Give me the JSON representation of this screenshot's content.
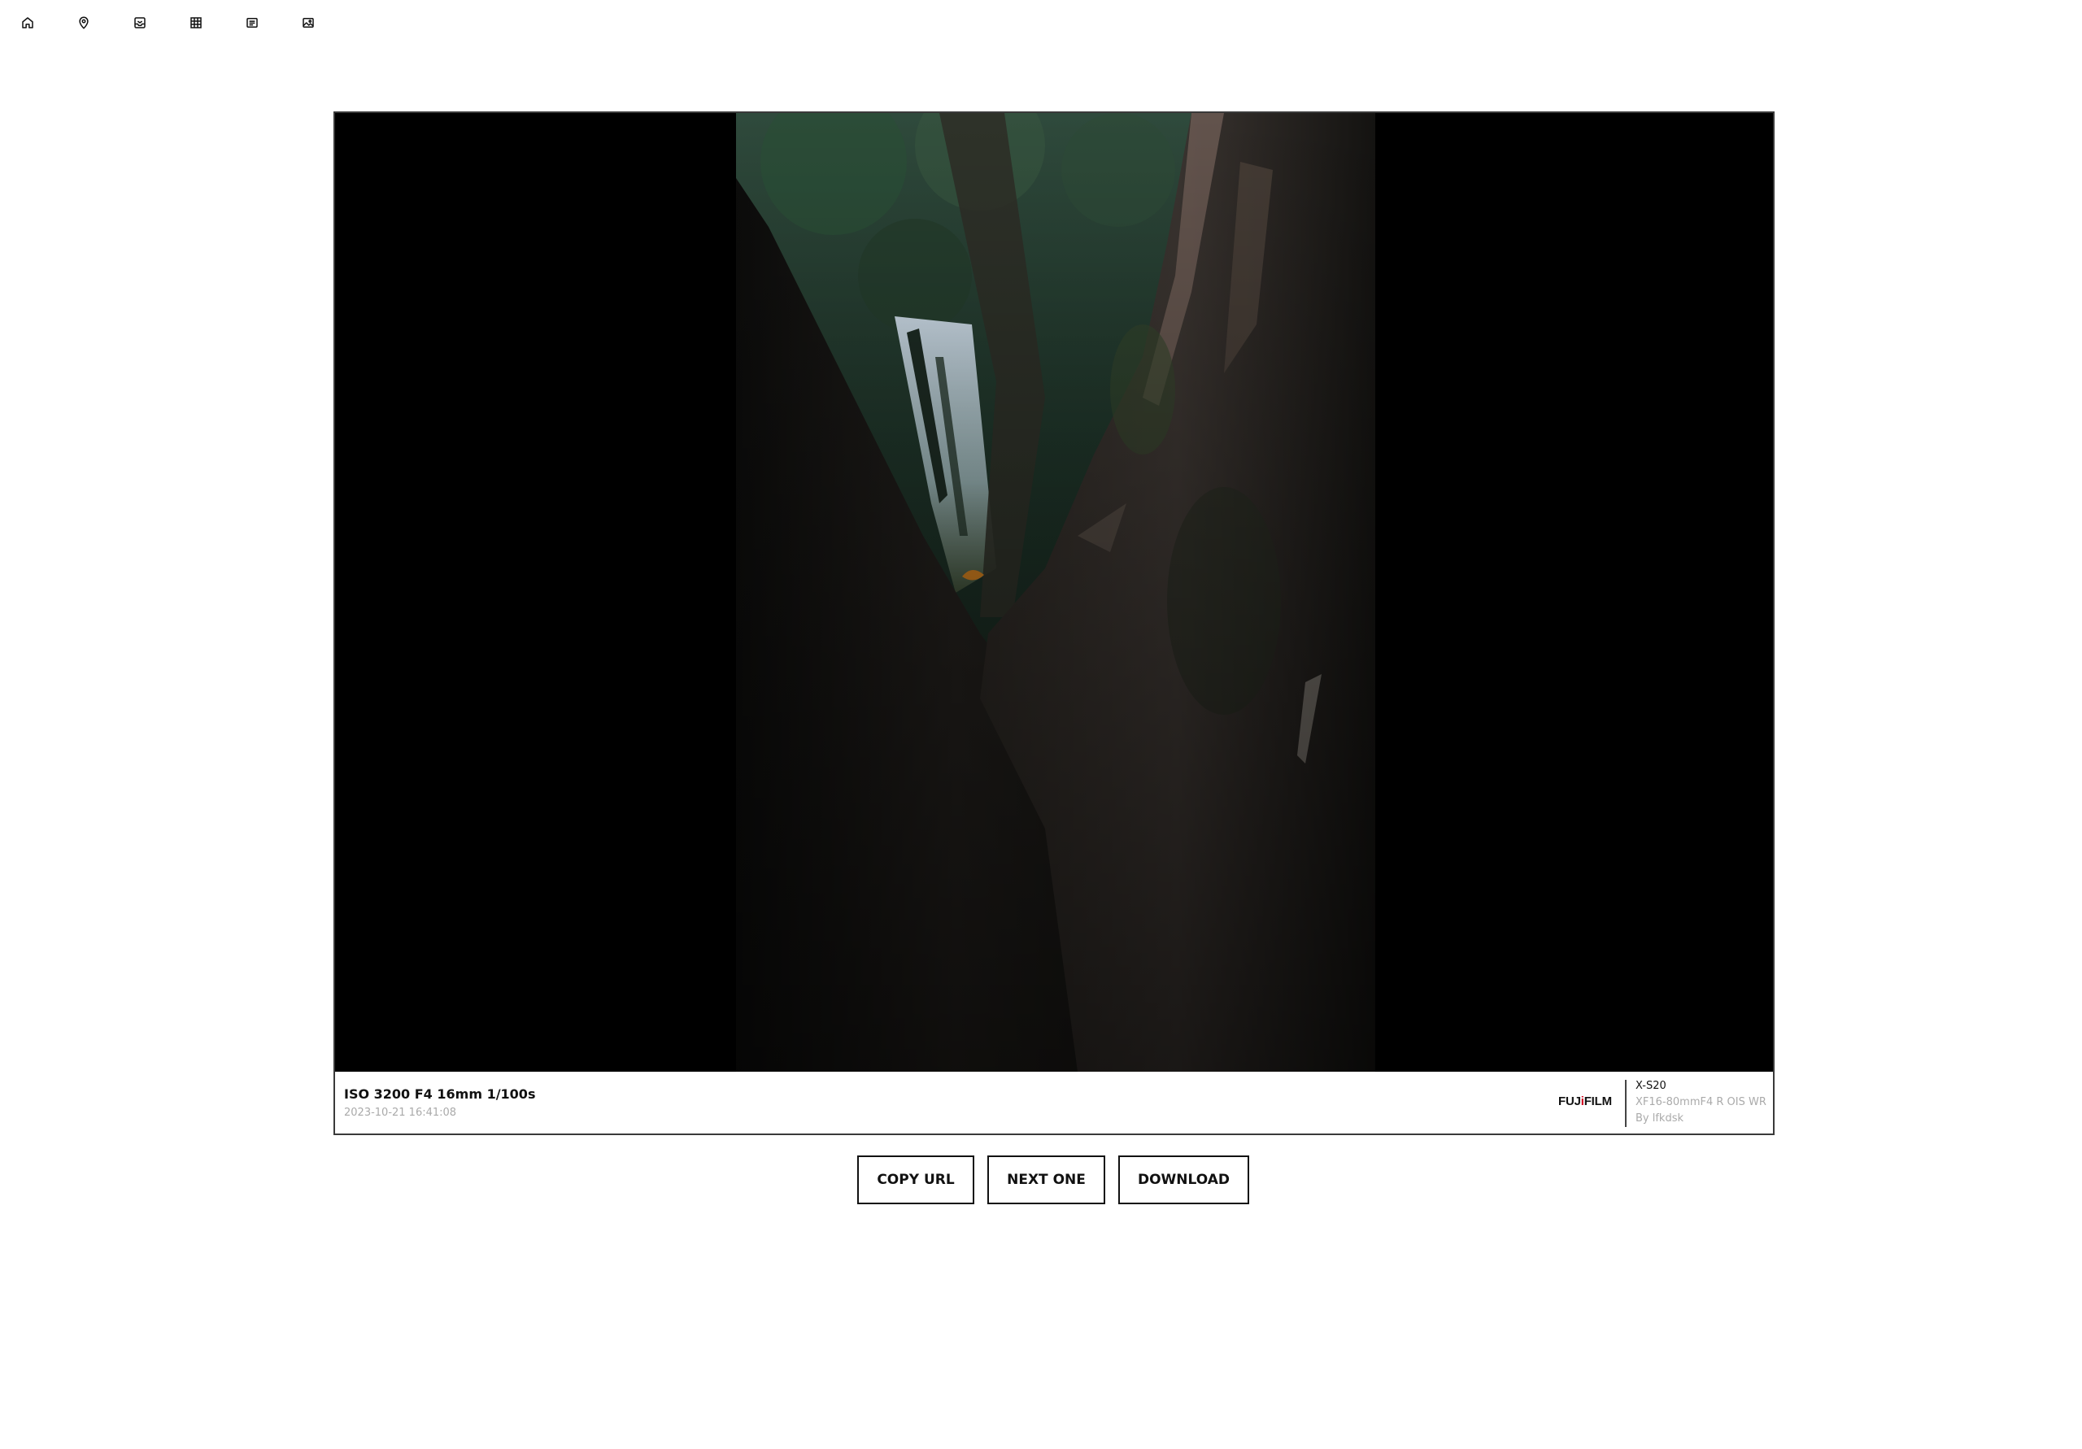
{
  "nav": {
    "items": [
      {
        "icon": "home-icon"
      },
      {
        "icon": "map-pin-icon"
      },
      {
        "icon": "inbox-icon"
      },
      {
        "icon": "grid-icon"
      },
      {
        "icon": "list-icon"
      },
      {
        "icon": "image-icon"
      }
    ]
  },
  "photo": {
    "exposure": "ISO 3200 F4 16mm 1/100s",
    "datetime": "2023-10-21 16:41:08",
    "brand_prefix": "FUJ",
    "brand_i": "i",
    "brand_suffix": "FILM",
    "camera_model": "X-S20",
    "lens": "XF16-80mmF4 R OIS WR",
    "author": "By lfkdsk"
  },
  "actions": {
    "copy_url": "COPY URL",
    "next_one": "NEXT ONE",
    "download": "DOWNLOAD"
  },
  "colors": {
    "frame_background": "#000000",
    "border": "#3a3a3a",
    "brand_accent": "#d0021b",
    "muted_text": "#aaaaaa"
  }
}
